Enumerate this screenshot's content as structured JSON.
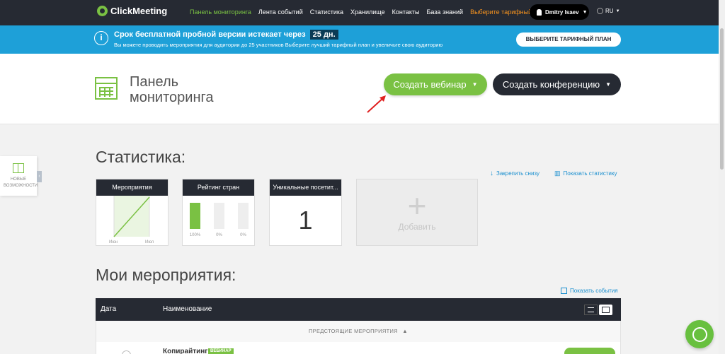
{
  "brand": {
    "name": "ClickMeeting",
    "accent": "#7ac143",
    "dark": "#262a33",
    "banner": "#1ea0d8"
  },
  "nav": {
    "items": [
      {
        "label": "Панель мониторинга"
      },
      {
        "label": "Лента событий"
      },
      {
        "label": "Статистика"
      },
      {
        "label": "Хранилище"
      },
      {
        "label": "Контакты"
      },
      {
        "label": "База знаний"
      },
      {
        "label": "Выберите тарифный план"
      }
    ],
    "user_name": "Dmitry Isaev",
    "language": "RU"
  },
  "banner": {
    "title": "Срок бесплатной пробной версии истекает через",
    "days": "25 дн.",
    "subtitle": "Вы можете проводить мероприятия для аудитории до 25 участников Выберите лучший тарифный план и увеличьте свою аудиторию",
    "button": "ВЫБЕРИТЕ ТАРИФНЫЙ ПЛАН"
  },
  "header": {
    "title": "Панель мониторинга",
    "webinar_button": "Создать вебинар",
    "conference_button": "Создать конференцию"
  },
  "side_widget": {
    "label": "НОВЫЕ ВОЗМОЖНОСТИ"
  },
  "stats": {
    "heading": "Статистика:",
    "pin_link": "Закрепить снизу",
    "show_link": "Показать статистику",
    "cards": {
      "events": {
        "title": "Мероприятия",
        "x_labels": [
          "Июн",
          "Июл"
        ]
      },
      "countries": {
        "title": "Рейтинг стран",
        "bars": [
          {
            "value": 100,
            "label": "100%"
          },
          {
            "value": 0,
            "label": "0%"
          },
          {
            "value": 0,
            "label": "0%"
          }
        ]
      },
      "visitors": {
        "title": "Уникальные посетит...",
        "value": "1"
      }
    },
    "add_label": "Добавить"
  },
  "events": {
    "heading": "Мои мероприятия:",
    "show_link": "Показать события",
    "columns": {
      "date": "Дата",
      "name": "Наименование"
    },
    "upcoming_label": "ПРЕДСТОЯЩИЕ МЕРОПРИЯТИЯ",
    "rows": [
      {
        "title": "Копирайтинг",
        "badge": "ВЕБИНАР"
      }
    ]
  }
}
